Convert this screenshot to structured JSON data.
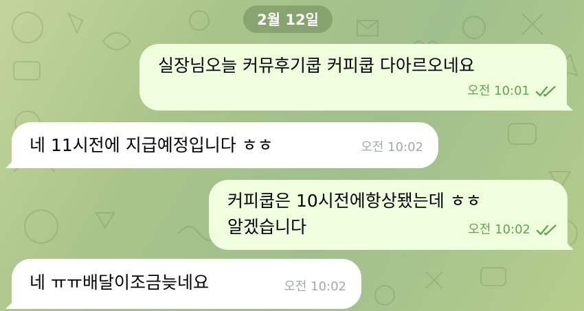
{
  "chat": {
    "date_label": "2월 12일",
    "messages": [
      {
        "direction": "outgoing",
        "lines": [
          "실장님오늘 커뮤후기쿱 커피쿱 다아르오네요"
        ],
        "time": "오전 10:01",
        "status_icon": "double-check-icon"
      },
      {
        "direction": "incoming",
        "lines": [
          "네 11시전에 지급예정입니다 ㅎㅎ"
        ],
        "time": "오전 10:02"
      },
      {
        "direction": "outgoing",
        "lines": [
          "커피쿱은 10시전에항상됐는데 ㅎㅎ",
          "알겠습니다"
        ],
        "time": "오전 10:02",
        "status_icon": "double-check-icon"
      },
      {
        "direction": "incoming",
        "lines": [
          "네 ㅠㅠ배달이조금늦네요"
        ],
        "time": "오전 10:02"
      }
    ]
  },
  "colors": {
    "outgoing_bubble": "#effedd",
    "incoming_bubble": "#ffffff",
    "read_check": "#5ea64f",
    "incoming_time": "#a3a9ad",
    "date_pill": "#6e8c5a"
  }
}
